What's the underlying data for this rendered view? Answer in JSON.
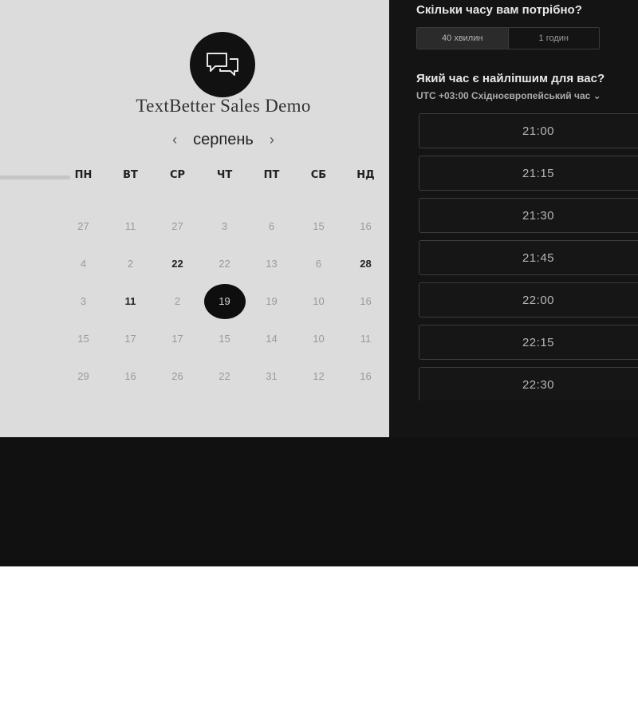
{
  "title": "TextBetter Sales Demo",
  "calendar": {
    "month": "серпень",
    "prev_arrow": "‹",
    "next_arrow": "›",
    "weekdays": [
      "ПН",
      "ВТ",
      "СР",
      "ЧТ",
      "ПТ",
      "СБ",
      "НД"
    ],
    "days": [
      {
        "label": "27",
        "state": "disabled"
      },
      {
        "label": "11",
        "state": "disabled"
      },
      {
        "label": "27",
        "state": "disabled"
      },
      {
        "label": "3",
        "state": "disabled"
      },
      {
        "label": "6",
        "state": "disabled"
      },
      {
        "label": "15",
        "state": "disabled"
      },
      {
        "label": "16",
        "state": "disabled"
      },
      {
        "label": "4",
        "state": "disabled"
      },
      {
        "label": "2",
        "state": "disabled"
      },
      {
        "label": "22",
        "state": "available"
      },
      {
        "label": "22",
        "state": "disabled"
      },
      {
        "label": "13",
        "state": "disabled"
      },
      {
        "label": "6",
        "state": "disabled"
      },
      {
        "label": "28",
        "state": "available"
      },
      {
        "label": "3",
        "state": "disabled"
      },
      {
        "label": "11",
        "state": "available"
      },
      {
        "label": "2",
        "state": "disabled"
      },
      {
        "label": "19",
        "state": "selected"
      },
      {
        "label": "19",
        "state": "disabled"
      },
      {
        "label": "10",
        "state": "disabled"
      },
      {
        "label": "16",
        "state": "disabled"
      },
      {
        "label": "15",
        "state": "disabled"
      },
      {
        "label": "17",
        "state": "disabled"
      },
      {
        "label": "17",
        "state": "disabled"
      },
      {
        "label": "15",
        "state": "disabled"
      },
      {
        "label": "14",
        "state": "disabled"
      },
      {
        "label": "10",
        "state": "disabled"
      },
      {
        "label": "11",
        "state": "disabled"
      },
      {
        "label": "29",
        "state": "disabled"
      },
      {
        "label": "16",
        "state": "disabled"
      },
      {
        "label": "26",
        "state": "disabled"
      },
      {
        "label": "22",
        "state": "disabled"
      },
      {
        "label": "31",
        "state": "disabled"
      },
      {
        "label": "12",
        "state": "disabled"
      },
      {
        "label": "16",
        "state": "disabled"
      }
    ]
  },
  "booking": {
    "duration_question": "Скільки часу вам потрібно?",
    "durations": [
      {
        "label": "40 хвилин",
        "active": true
      },
      {
        "label": "1 годин",
        "active": false
      }
    ],
    "time_question": "Який час є найліпшим для вас?",
    "timezone": "UTC +03:00 Східноєвропейський час",
    "timezone_chevron": "⌄",
    "slots": [
      "21:00",
      "21:15",
      "21:30",
      "21:45",
      "22:00",
      "22:15",
      "22:30",
      ""
    ]
  },
  "colors": {
    "left_bg": "#dcdcdc",
    "right_bg": "#141414",
    "selected_day": "#0e0e0e"
  }
}
